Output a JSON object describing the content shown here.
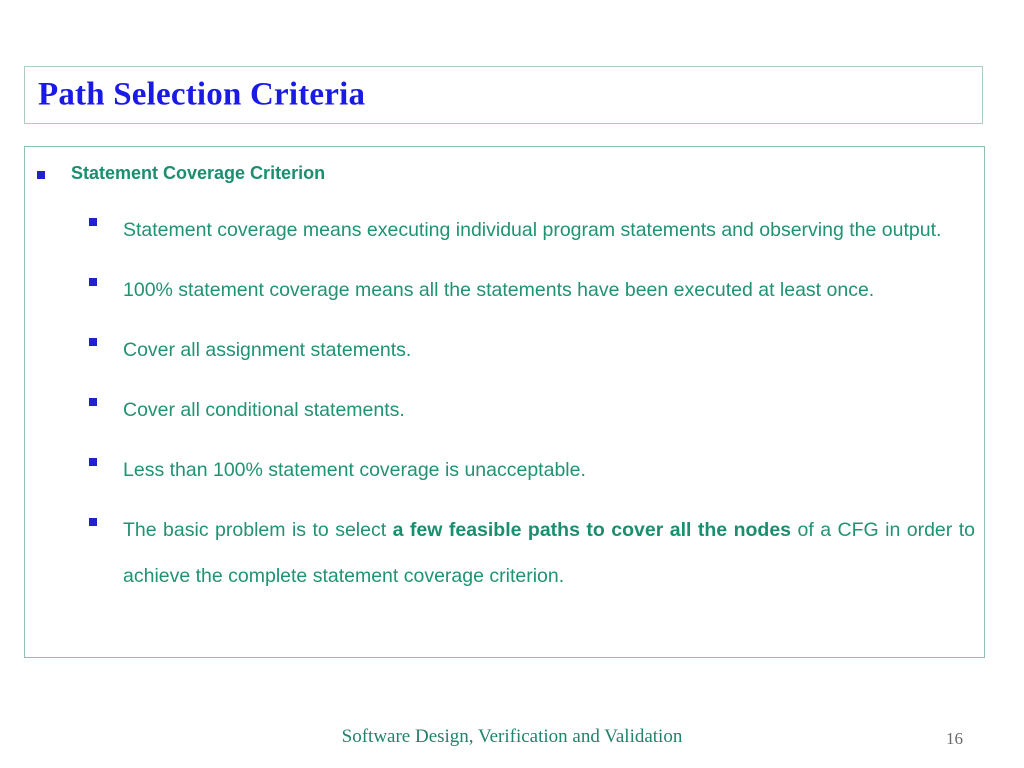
{
  "slide": {
    "title": "Path Selection Criteria",
    "heading": "Statement Coverage Criterion",
    "bullets": [
      {
        "pre": "Statement coverage means executing individual program statements and observing the output.",
        "bold": "",
        "post": "",
        "justify": true
      },
      {
        "pre": "100% statement coverage means all the statements have been executed at least once.",
        "bold": "",
        "post": "",
        "justify": true
      },
      {
        "pre": "Cover all assignment statements.",
        "bold": "",
        "post": "",
        "justify": false
      },
      {
        "pre": "Cover all conditional statements.",
        "bold": "",
        "post": "",
        "justify": false
      },
      {
        "pre": "Less than 100% statement coverage is unacceptable.",
        "bold": "",
        "post": "",
        "justify": false
      },
      {
        "pre": "The basic problem is to select ",
        "bold": "a few feasible paths to cover all the nodes",
        "post": " of a CFG in order to achieve the complete statement coverage criterion.",
        "justify": true
      }
    ]
  },
  "footer": {
    "text": "Software Design,  Verification and Validation",
    "page_number": "16"
  },
  "colors": {
    "title_blue": "#1a1ae6",
    "body_teal": "#1f9372",
    "heading_teal": "#1a8f6f",
    "bullet_blue": "#2222cc",
    "box_border": "#8dbfb2",
    "footer_teal": "#22826c",
    "page_gray": "#6b6b6b"
  }
}
